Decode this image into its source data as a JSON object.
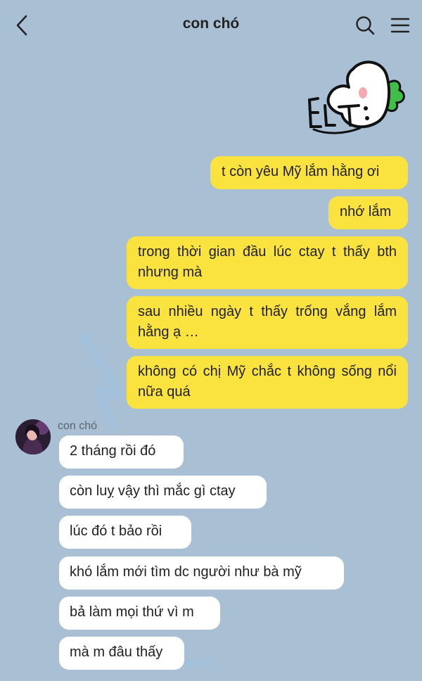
{
  "header": {
    "back_icon": "chevron-left-icon",
    "title": "con chó",
    "search_icon": "search-icon",
    "menu_icon": "menu-icon"
  },
  "sticker": {
    "name": "bunny-sticker",
    "text": "ĘLT:"
  },
  "sent_messages": [
    "t còn yêu Mỹ lắm hằng ơi",
    "nhớ lắm",
    "trong thời gian đầu lúc ctay t thấy bth nhưng mà",
    "sau nhiều ngày t thấy trống vắng lắm hằng ạ …",
    "không có chị Mỹ chắc t không sống nổi nữa quá"
  ],
  "received": {
    "sender_name": "con chó",
    "messages": [
      "2 tháng rồi đó",
      "còn luỵ vậy thì mắc gì ctay",
      "lúc đó t bảo rồi",
      "khó lắm mới tìm dc người như bà mỹ",
      "bả làm mọi thứ vì m",
      "mà m đâu thấy"
    ]
  },
  "colors": {
    "background": "#a9bfd4",
    "sent_bubble": "#fbe33f",
    "received_bubble": "#ffffff"
  }
}
